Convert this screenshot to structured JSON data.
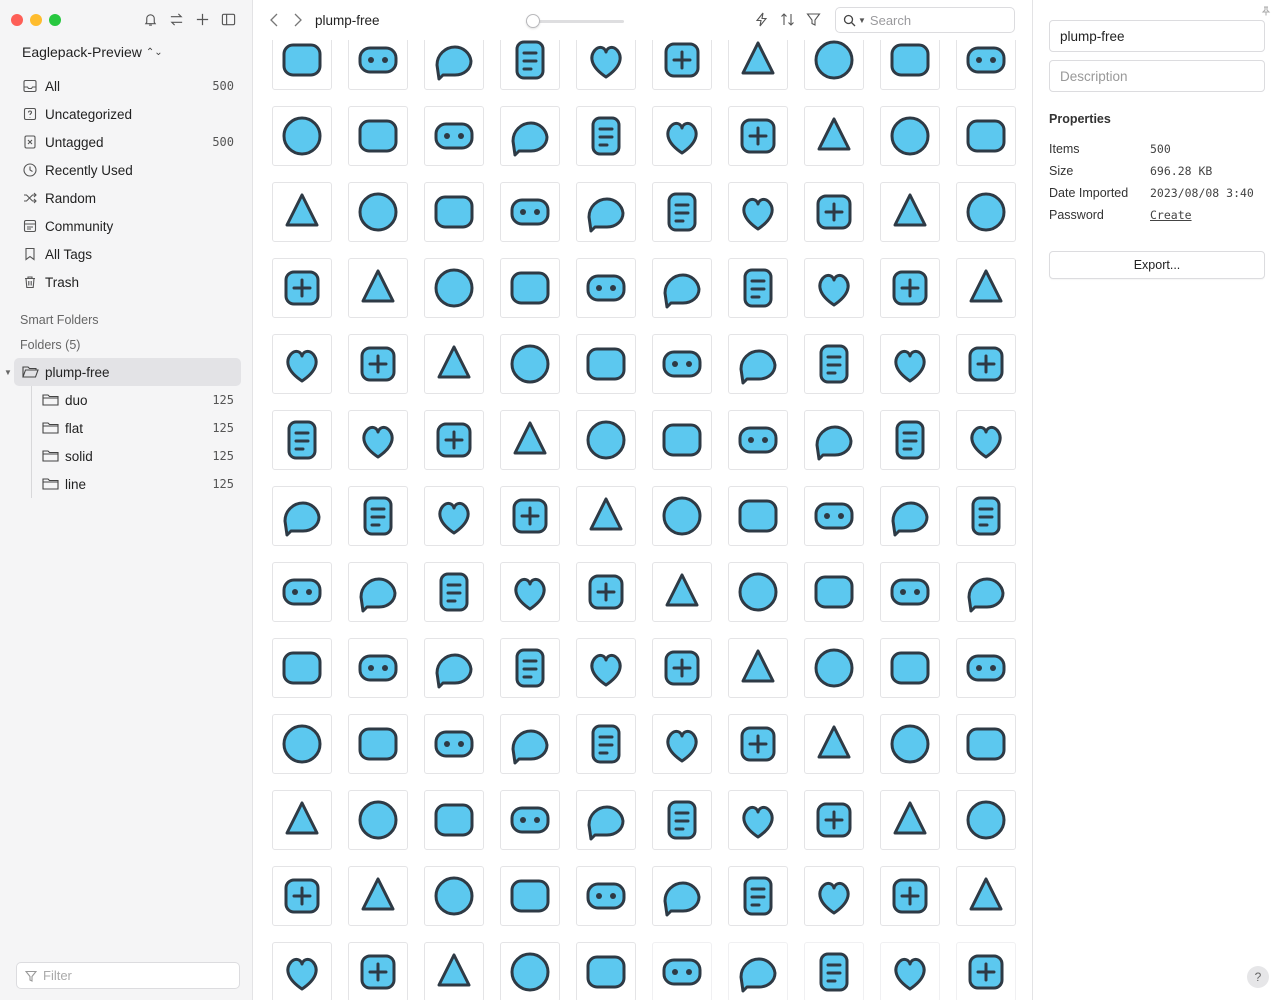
{
  "window": {
    "traffic_lights": [
      "#fe5f57",
      "#febc2e",
      "#28c840"
    ]
  },
  "sidebar": {
    "library_name": "Eaglepack-Preview",
    "library_switch_icon": "chevron-updown-icon",
    "tools": [
      "bell-icon",
      "sync-arrows-icon",
      "plus-icon",
      "sidebar-toggle-icon"
    ],
    "items": [
      {
        "label": "All",
        "count": "500",
        "icon": "inbox-icon"
      },
      {
        "label": "Uncategorized",
        "count": "",
        "icon": "question-box-icon"
      },
      {
        "label": "Untagged",
        "count": "500",
        "icon": "untagged-icon"
      },
      {
        "label": "Recently Used",
        "count": "",
        "icon": "clock-icon"
      },
      {
        "label": "Random",
        "count": "",
        "icon": "shuffle-icon"
      },
      {
        "label": "Community",
        "count": "",
        "icon": "community-icon"
      },
      {
        "label": "All Tags",
        "count": "",
        "icon": "bookmark-icon"
      },
      {
        "label": "Trash",
        "count": "",
        "icon": "trash-icon"
      }
    ],
    "smart_folders_label": "Smart Folders",
    "folders_label": "Folders (5)",
    "folders": [
      {
        "label": "plump-free",
        "count": "",
        "active": true
      },
      {
        "label": "duo",
        "count": "125"
      },
      {
        "label": "flat",
        "count": "125"
      },
      {
        "label": "solid",
        "count": "125"
      },
      {
        "label": "line",
        "count": "125"
      }
    ],
    "filter_placeholder": "Filter"
  },
  "toolbar": {
    "breadcrumb": "plump-free",
    "thumbnail_size": 0,
    "icons": [
      "quick-action-icon",
      "sort-icon",
      "filter-funnel-icon"
    ],
    "search_placeholder": "Search"
  },
  "grid": {
    "accent": "#5cc8ef",
    "outline": "#2e3a45",
    "columns": 10,
    "icons": [
      "battery-charging",
      "battery-low",
      "bluetooth",
      "wifi",
      "gamepad",
      "command-key",
      "keyboard",
      "laptop",
      "spotify",
      "dropbox",
      "facebook",
      "mouse",
      "printer",
      "robot",
      "monitor",
      "smartwatch",
      "microphone",
      "video-camera",
      "alien",
      "telescope",
      "test-tube",
      "burger",
      "coffee-cup",
      "wine-glass",
      "chicken-leg",
      "popsicle",
      "chef-hat",
      "fork-knife",
      "fridge",
      "strawberry",
      "watermelon",
      "camera",
      "lightning",
      "image-gallery",
      "bell-add",
      "radioactive",
      "swap-arrows",
      "expand-arrows",
      "refresh",
      "calendar-check",
      "archive-box",
      "cursor-arrow",
      "download-tray",
      "paint-brush",
      "scissors",
      "layers",
      "pencil",
      "skull",
      "bezier-nodes",
      "closed-captions",
      "sparkles",
      "star-badge",
      "document",
      "folder",
      "ok-hand",
      "tap-gesture",
      "help-bubble",
      "face-scan",
      "coin",
      "moon",
      "lightbulb",
      "touch-sliders",
      "search-scan",
      "shield",
      "sliders-panel",
      "heart-rate",
      "funnel",
      "list-layout",
      "text-frame",
      "user-avatar",
      "storm-cloud",
      "smile-chat",
      "alert-chat",
      "chat-bubbles",
      "inbox-tray",
      "mail-notification",
      "mailbox",
      "attached-file",
      "send",
      "at-sign",
      "laughing-face",
      "star-eyes-face",
      "tears-face",
      "podium",
      "money-bag",
      "dollar-monitor",
      "pound-coin",
      "growth-chart",
      "safe",
      "recycle",
      "dog",
      "cactus",
      "sunrise",
      "tree",
      "earth",
      "add-apps",
      "browser-window",
      "bug",
      "cloud-off",
      "cube",
      "rss-feed",
      "html5",
      "globe",
      "shopping-basket",
      "gift",
      "diamond",
      "airplane-landing",
      "room-service",
      "star-five",
      "location-pin",
      "heart-pin",
      "person-location",
      "paper-plane-off",
      "flag",
      "map",
      "island",
      "building",
      "bicycle",
      "bus",
      "head-idea",
      "escalator",
      "running-exit",
      "gender",
      "elevator",
      "medical-bag",
      "battery-charging-solid",
      "battery-low-solid",
      "bluetooth-solid",
      "wifi-solid",
      "gamepad-solid"
    ]
  },
  "inspector": {
    "name_value": "plump-free",
    "description_placeholder": "Description",
    "properties_title": "Properties",
    "properties": [
      {
        "key": "Items",
        "value": "500"
      },
      {
        "key": "Size",
        "value": "696.28 KB"
      },
      {
        "key": "Date Imported",
        "value": "2023/08/08 3:40"
      },
      {
        "key": "Password",
        "value": "Create",
        "link": true
      }
    ],
    "export_label": "Export...",
    "help_label": "?"
  }
}
